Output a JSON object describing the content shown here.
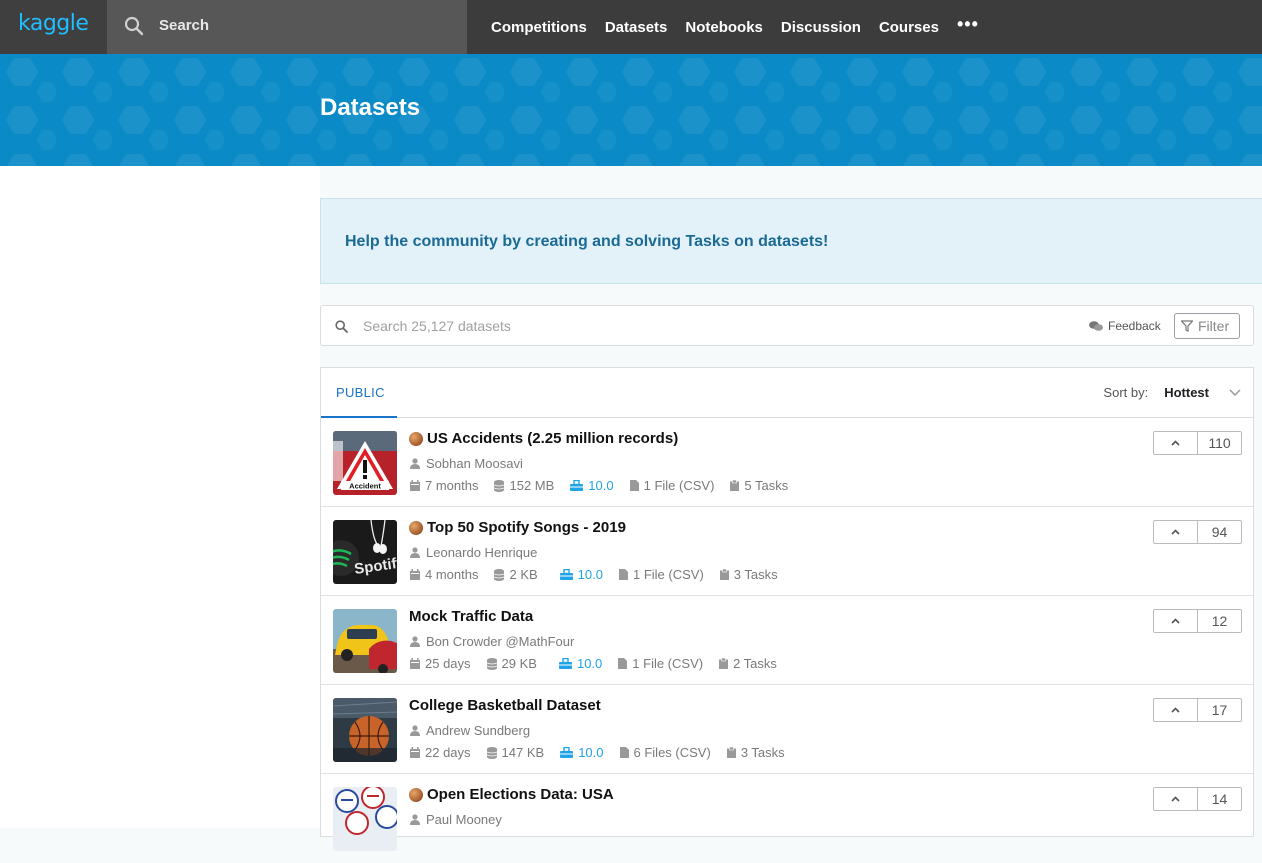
{
  "nav": {
    "logo": "kaggle",
    "search_placeholder": "Search",
    "links": [
      "Competitions",
      "Datasets",
      "Notebooks",
      "Discussion",
      "Courses"
    ],
    "more": "•••"
  },
  "hero": {
    "title": "Datasets"
  },
  "banner": {
    "text": "Help the community by creating and solving Tasks on datasets!"
  },
  "dataset_search": {
    "placeholder": "Search 25,127 datasets",
    "feedback_label": "Feedback",
    "filter_label": "Filter"
  },
  "tabs": {
    "public": "PUBLIC",
    "sort_label": "Sort by:",
    "sort_value": "Hottest"
  },
  "datasets": [
    {
      "title": "US Accidents (2.25 million records)",
      "medal": true,
      "owner": "Sobhan Moosavi",
      "updated": "7 months",
      "size": "152 MB",
      "usability": "10.0",
      "files": "1 File (CSV)",
      "tasks": "5 Tasks",
      "votes": "110",
      "thumb": "accident"
    },
    {
      "title": "Top 50 Spotify Songs - 2019",
      "medal": true,
      "owner": "Leonardo Henrique",
      "updated": "4 months",
      "size": "2 KB",
      "usability": "10.0",
      "files": "1 File (CSV)",
      "tasks": "3 Tasks",
      "votes": "94",
      "thumb": "spotify"
    },
    {
      "title": "Mock Traffic Data",
      "medal": false,
      "owner": "Bon Crowder @MathFour",
      "updated": "25 days",
      "size": "29 KB",
      "usability": "10.0",
      "files": "1 File (CSV)",
      "tasks": "2 Tasks",
      "votes": "12",
      "thumb": "cars"
    },
    {
      "title": "College Basketball Dataset",
      "medal": false,
      "owner": "Andrew Sundberg",
      "updated": "22 days",
      "size": "147 KB",
      "usability": "10.0",
      "files": "6 Files (CSV)",
      "tasks": "3 Tasks",
      "votes": "17",
      "thumb": "basketball"
    },
    {
      "title": "Open Elections Data: USA",
      "medal": true,
      "owner": "Paul Mooney",
      "updated": "",
      "size": "",
      "usability": "",
      "files": "",
      "tasks": "",
      "votes": "14",
      "thumb": "elections"
    }
  ],
  "colors": {
    "nav_bg": "#3c3c3c",
    "hero_bg": "#0a8ac6",
    "logo": "#20beff",
    "usability": "#20a4e8",
    "tab_active": "#1a73c8"
  }
}
